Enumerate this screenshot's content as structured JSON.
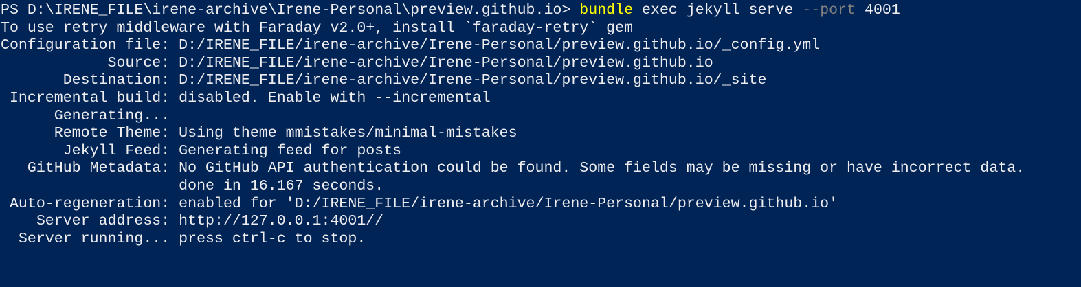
{
  "window": {
    "background": "#012456",
    "foreground": "#eeedf0"
  },
  "prompt": {
    "path": "PS D:\\IRENE_FILE\\irene-archive\\Irene-Personal\\preview.github.io> ",
    "command": "bundle",
    "args1": " exec jekyll serve ",
    "param": "--port",
    "args2": " 4001",
    "command_color": "#ffff00",
    "param_color": "#808080"
  },
  "output": [
    "To use retry middleware with Faraday v2.0+, install `faraday-retry` gem",
    "Configuration file: D:/IRENE_FILE/irene-archive/Irene-Personal/preview.github.io/_config.yml",
    "            Source: D:/IRENE_FILE/irene-archive/Irene-Personal/preview.github.io",
    "       Destination: D:/IRENE_FILE/irene-archive/Irene-Personal/preview.github.io/_site",
    " Incremental build: disabled. Enable with --incremental",
    "      Generating...",
    "      Remote Theme: Using theme mmistakes/minimal-mistakes",
    "       Jekyll Feed: Generating feed for posts",
    "   GitHub Metadata: No GitHub API authentication could be found. Some fields may be missing or have incorrect data.",
    "                    done in 16.167 seconds.",
    " Auto-regeneration: enabled for 'D:/IRENE_FILE/irene-archive/Irene-Personal/preview.github.io'",
    "    Server address: http://127.0.0.1:4001//",
    "  Server running... press ctrl-c to stop."
  ]
}
